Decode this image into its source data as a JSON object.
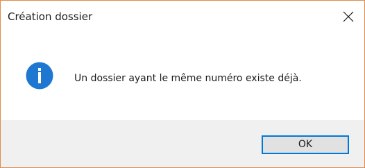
{
  "window": {
    "title": "Création dossier",
    "close_icon": "close-icon",
    "accent_border": "#e08a4b"
  },
  "content": {
    "icon": "info-icon",
    "icon_color": "#1e78d2",
    "message": "Un dossier ayant le même numéro existe déjà."
  },
  "footer": {
    "ok_label": "OK",
    "ok_focus_color": "#0078d7"
  }
}
